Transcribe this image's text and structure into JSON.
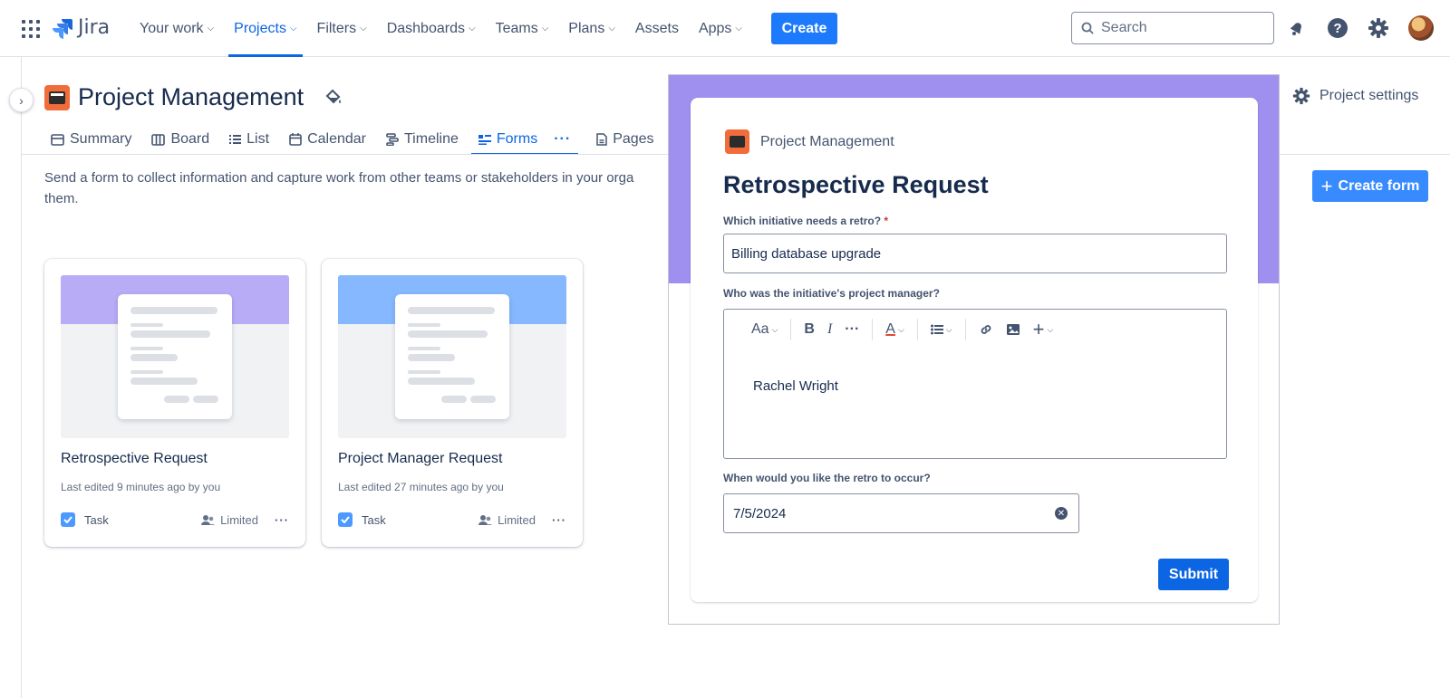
{
  "nav": {
    "logo": "Jira",
    "items": [
      {
        "label": "Your work",
        "dropdown": true
      },
      {
        "label": "Projects",
        "dropdown": true,
        "active": true
      },
      {
        "label": "Filters",
        "dropdown": true
      },
      {
        "label": "Dashboards",
        "dropdown": true
      },
      {
        "label": "Teams",
        "dropdown": true
      },
      {
        "label": "Plans",
        "dropdown": true
      },
      {
        "label": "Assets",
        "dropdown": false
      },
      {
        "label": "Apps",
        "dropdown": true
      }
    ],
    "create_label": "Create",
    "search_placeholder": "Search"
  },
  "project": {
    "title": "Project Management",
    "settings_label": "Project settings",
    "tabs": [
      {
        "label": "Summary",
        "icon": "summary-icon"
      },
      {
        "label": "Board",
        "icon": "board-icon"
      },
      {
        "label": "List",
        "icon": "list-icon"
      },
      {
        "label": "Calendar",
        "icon": "calendar-icon"
      },
      {
        "label": "Timeline",
        "icon": "timeline-icon"
      },
      {
        "label": "Forms",
        "icon": "forms-icon",
        "active": true
      },
      {
        "label": "Pages",
        "icon": "pages-icon"
      }
    ],
    "tabs_more": "···"
  },
  "forms_page": {
    "description": "Send a form to collect information and capture work from other teams or stakeholders in your orga",
    "description_line2": "them.",
    "create_form_label": "Create form",
    "cards": [
      {
        "title": "Retrospective Request",
        "meta": "Last edited 9 minutes ago by you",
        "type": "Task",
        "access": "Limited",
        "band_color": "#b8acf6",
        "more": "···"
      },
      {
        "title": "Project Manager Request",
        "meta": "Last edited 27 minutes ago by you",
        "type": "Task",
        "access": "Limited",
        "band_color": "#85b8ff",
        "more": "···"
      }
    ]
  },
  "preview": {
    "band_color": "#9f8fef",
    "project_name": "Project Management",
    "form_title": "Retrospective Request",
    "q1_label": "Which initiative needs a retro?",
    "q1_required": "*",
    "q1_value": "Billing database upgrade",
    "q2_label": "Who was the initiative's project manager?",
    "q2_value": "Rachel Wright",
    "toolbar": {
      "text_style": "Aa",
      "bold": "B",
      "italic": "I",
      "more": "···",
      "color": "A"
    },
    "q3_label": "When would you like the retro to occur?",
    "q3_value": "7/5/2024",
    "submit_label": "Submit"
  }
}
